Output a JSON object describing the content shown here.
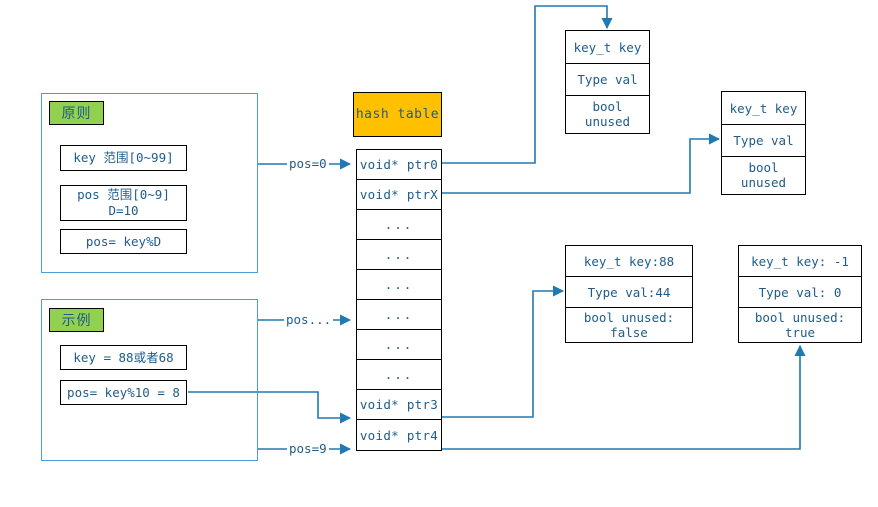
{
  "colors": {
    "panel_border": "#4a9fd8",
    "badge_fill": "#92d050",
    "table_head_fill": "#ffc000",
    "text": "#1f5c8b",
    "box_border": "#000000",
    "wire": "#2079b0"
  },
  "principle_panel": {
    "badge": "原则",
    "boxes": [
      {
        "text": "key 范围[0~99]"
      },
      {
        "text": "pos 范围[0~9]\nD=10"
      },
      {
        "text": "pos= key%D"
      }
    ]
  },
  "example_panel": {
    "badge": "示例",
    "boxes": [
      {
        "text": "key = 88或者68"
      },
      {
        "text": "pos= key%10 = 8"
      }
    ]
  },
  "hash_table": {
    "title": "hash table",
    "slots": [
      {
        "label": "void* ptr0"
      },
      {
        "label": "void* ptrX"
      },
      {
        "label": "..."
      },
      {
        "label": "..."
      },
      {
        "label": "..."
      },
      {
        "label": "..."
      },
      {
        "label": "..."
      },
      {
        "label": "..."
      },
      {
        "label": "void* ptr3"
      },
      {
        "label": "void* ptr4"
      }
    ]
  },
  "edge_labels": {
    "pos0": "pos=0",
    "pos_dots": "pos...",
    "pos9": "pos=9"
  },
  "nodes": {
    "generic_top": {
      "key": "key_t key",
      "val": "Type val",
      "unused": "bool\nunused"
    },
    "generic_right": {
      "key": "key_t key",
      "val": "Type val",
      "unused": "bool\nunused"
    },
    "used_entry": {
      "key": "key_t key:88",
      "val": "Type val:44",
      "unused": "bool unused:\nfalse"
    },
    "free_entry": {
      "key": "key_t key: -1",
      "val": "Type val: 0",
      "unused": "bool unused:\ntrue"
    }
  }
}
